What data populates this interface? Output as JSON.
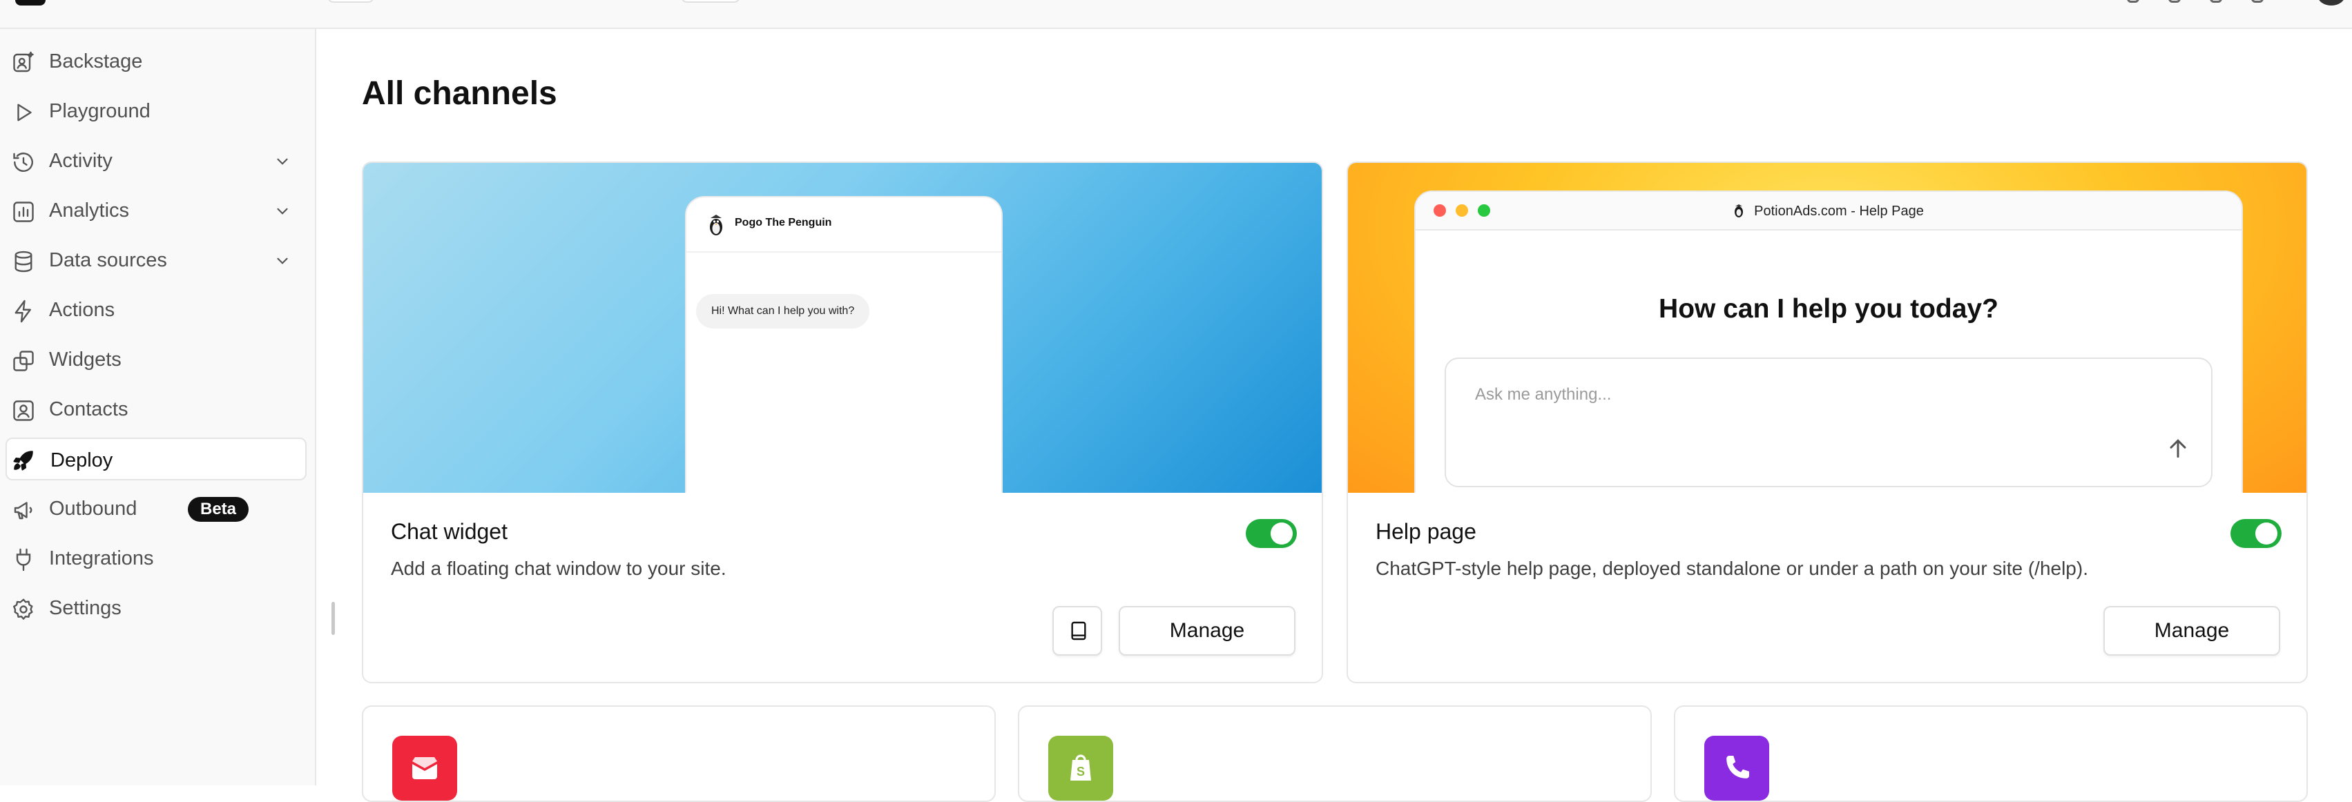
{
  "sidebar": {
    "items": [
      {
        "label": "Backstage",
        "icon": "user-star-icon"
      },
      {
        "label": "Playground",
        "icon": "play-icon"
      },
      {
        "label": "Activity",
        "icon": "history-icon",
        "expandable": true
      },
      {
        "label": "Analytics",
        "icon": "bar-chart-icon",
        "expandable": true
      },
      {
        "label": "Data sources",
        "icon": "database-icon",
        "expandable": true
      },
      {
        "label": "Actions",
        "icon": "lightning-icon"
      },
      {
        "label": "Widgets",
        "icon": "widgets-icon"
      },
      {
        "label": "Contacts",
        "icon": "contact-icon"
      },
      {
        "label": "Deploy",
        "icon": "rocket-icon",
        "active": true
      },
      {
        "label": "Outbound",
        "icon": "megaphone-icon",
        "badge": "Beta"
      },
      {
        "label": "Integrations",
        "icon": "plug-icon"
      },
      {
        "label": "Settings",
        "icon": "gear-icon"
      }
    ]
  },
  "main": {
    "title": "All channels",
    "cards": [
      {
        "title": "Chat widget",
        "description": "Add a floating chat window to your site.",
        "enabled": true,
        "manage_label": "Manage",
        "preview": {
          "bot_name": "Pogo The Penguin",
          "greeting": "Hi! What can I help you with?"
        }
      },
      {
        "title": "Help page",
        "description": "ChatGPT-style help page, deployed standalone or under a path on your site (/help).",
        "enabled": true,
        "manage_label": "Manage",
        "preview": {
          "browser_title": "PotionAds.com - Help Page",
          "heading": "How can I help you today?",
          "placeholder": "Ask me anything..."
        }
      }
    ],
    "more_channels": [
      {
        "icon": "email-icon",
        "color": "#f0263c"
      },
      {
        "icon": "shopify-icon",
        "color": "#8dbb3c"
      },
      {
        "icon": "phone-icon",
        "color": "#8a2be2"
      }
    ]
  },
  "colors": {
    "toggle_on": "#1fae3e",
    "badge_bg": "#111111"
  }
}
